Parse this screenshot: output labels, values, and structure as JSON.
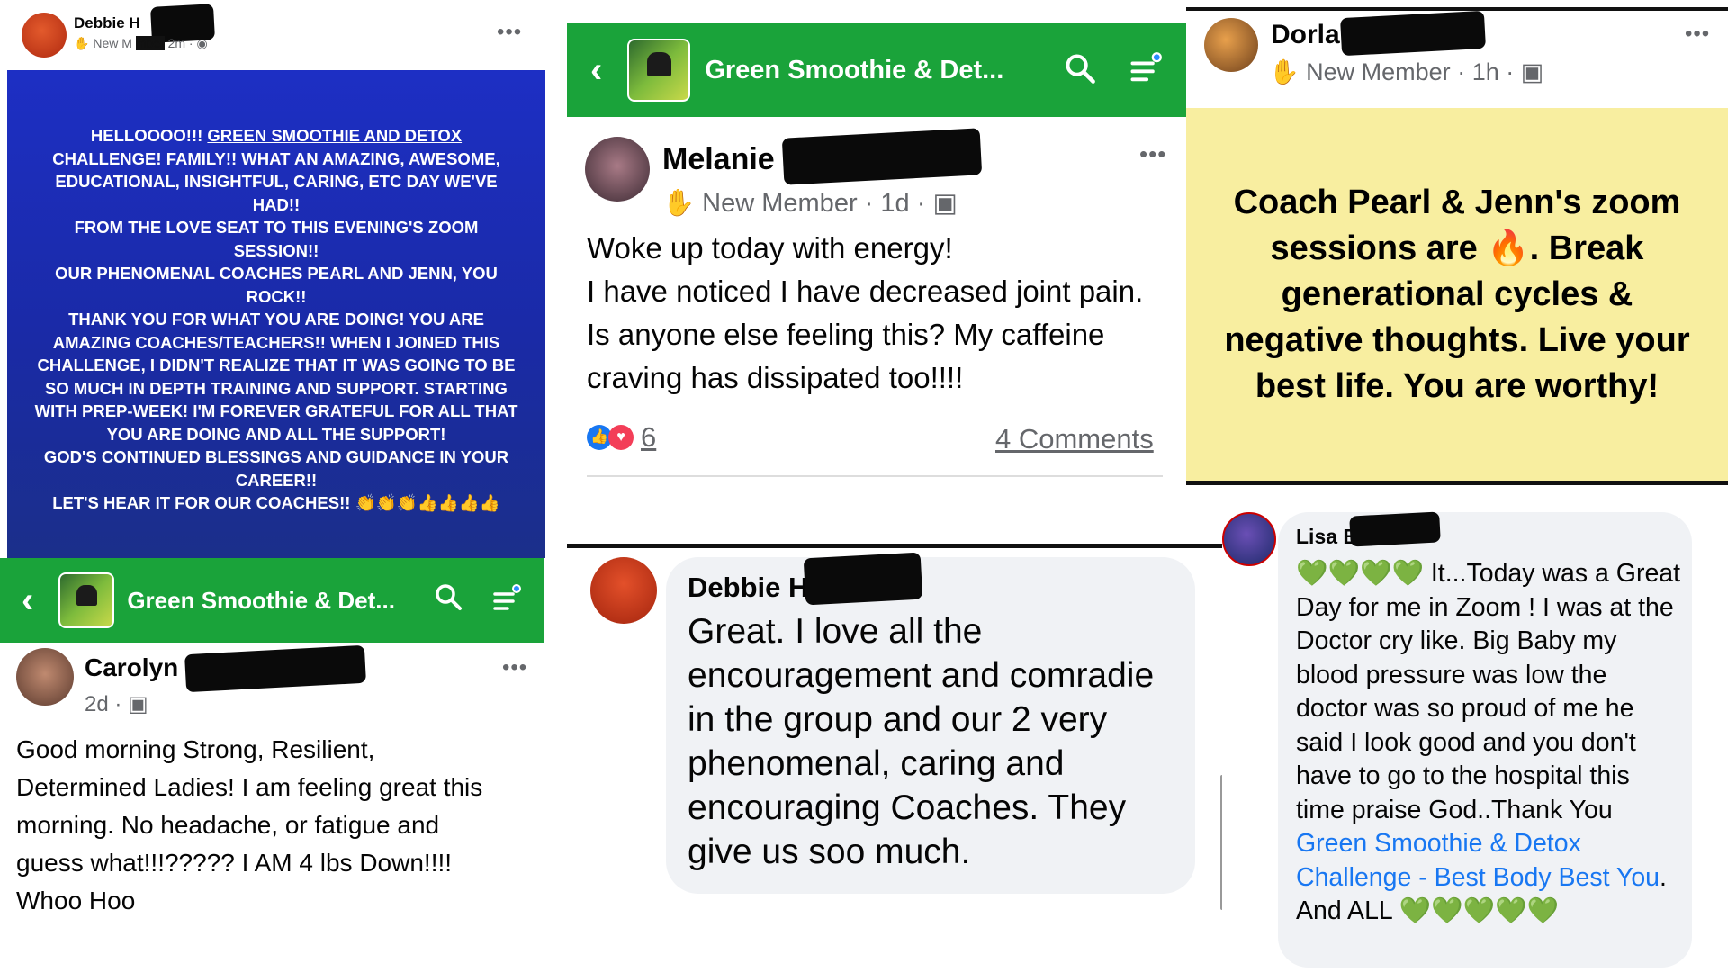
{
  "panel1": {
    "author": "Debbie H",
    "meta": "New M",
    "time": "2m",
    "post_lines_before_link": "HELLOOOO!!! ",
    "link_text": "Green Smoothie and Detox Challenge!",
    "post_body": "FAMILY!! WHAT AN AMAZING, AWESOME, EDUCATIONAL, INSIGHTFUL, CARING, ETC DAY WE'VE HAD!!\nFROM THE LOVE SEAT TO THIS EVENING'S ZOOM SESSION!!\nOUR PHENOMENAL COACHES PEARL AND JENN, YOU ROCK!!\nTHANK YOU FOR WHAT YOU ARE DOING! YOU ARE AMAZING COACHES/TEACHERS!! WHEN I JOINED THIS CHALLENGE, I DIDN'T REALIZE THAT IT WAS GOING TO BE SO MUCH IN DEPTH TRAINING AND SUPPORT. STARTING WITH PREP-WEEK! I'M FOREVER GRATEFUL FOR ALL THAT YOU ARE DOING AND ALL THE SUPPORT!\nGOD'S CONTINUED BLESSINGS AND GUIDANCE IN YOUR CAREER!!\nLET'S HEAR IT FOR OUR COACHES!!",
    "emoji_tail": "👏👏👏👍👍👍👍"
  },
  "panel2": {
    "group_title": "Green Smoothie & Det...",
    "author": "Carolyn",
    "time": "2d",
    "body": "Good morning Strong, Resilient, Determined Ladies!  I am feeling great this morning.  No headache, or fatigue and guess what!!!?????  I AM 4 lbs Down!!!!  Whoo Hoo"
  },
  "panel3": {
    "group_title": "Green Smoothie & Det...",
    "author": "Melanie K",
    "badge": "New Member",
    "time": "1d",
    "body": "Woke up today with energy!\nI have noticed I have decreased joint pain. Is anyone else feeling this?  My caffeine craving has dissipated too!!!!",
    "reaction_count": "6",
    "comments_label": "4 Comments"
  },
  "panel4": {
    "author": "Debbie H",
    "body": "Great. I love all the encouragement and comradie in the group and our 2 very phenomenal, caring and encouraging Coaches. They give us soo much."
  },
  "panel5": {
    "author": "Dorla",
    "badge": "New Member",
    "time": "1h",
    "post": "Coach Pearl & Jenn's zoom sessions are 🔥. Break generational cycles & negative thoughts. Live your best life. You are worthy!",
    "bg_color": "#f8eea0"
  },
  "panel6": {
    "author": "Lisa B",
    "hearts_lead": "💚💚💚💚",
    "body_before_link": " It...Today was a Great Day for me in Zoom ! I was at the Doctor cry like. Big Baby my blood pressure was low the doctor was so proud of me he said I look good and you don't have to go to the hospital this time praise God..Thank You ",
    "link_text": "Green Smoothie & Detox Challenge - Best Body Best You",
    "body_after_link": ". And ALL ",
    "hearts_tail": "💚💚💚💚💚"
  },
  "icons": [
    "back-icon",
    "search-icon",
    "menu-icon",
    "globe-icon",
    "group-icon",
    "like-icon",
    "love-icon",
    "more-icon",
    "wave-icon"
  ],
  "colors": {
    "fb_green": "#1aa33a",
    "link_blue": "#1877f2",
    "post_blue": "#1a2fa8",
    "comment_bg": "#f0f2f5"
  }
}
